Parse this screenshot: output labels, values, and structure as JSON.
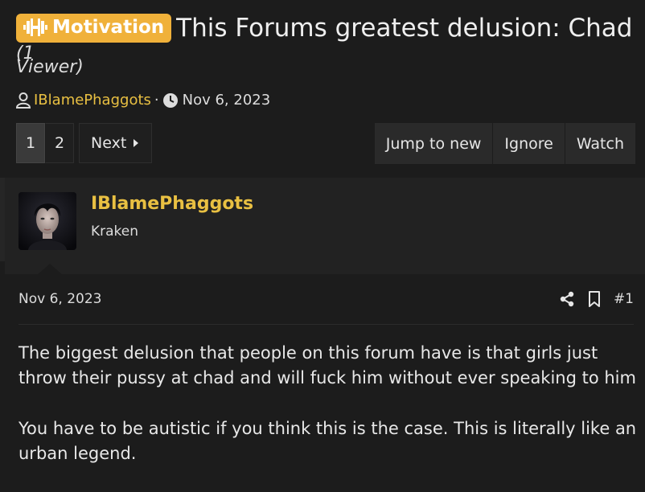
{
  "thread": {
    "prefix_label": "Motivation",
    "title": "This Forums greatest delusion: Chad",
    "viewer_count_part1": "(1",
    "viewer_count_part2": "Viewer)",
    "author": "IBlamePhaggots",
    "separator": "·",
    "date": "Nov 6, 2023"
  },
  "pagination": {
    "pages": [
      "1",
      "2"
    ],
    "current": "1",
    "next_label": "Next"
  },
  "actions": {
    "jump_label": "Jump to new",
    "ignore_label": "Ignore",
    "watch_label": "Watch"
  },
  "post": {
    "username": "IBlamePhaggots",
    "user_title": "Kraken",
    "date": "Nov 6, 2023",
    "post_number": "#1",
    "paragraphs": [
      "The biggest delusion that people on this forum have is that girls just throw their pussy at chad and will fuck him without ever speaking to him",
      "You have to be autistic if you think this is the case. This is literally like an urban legend."
    ]
  },
  "colors": {
    "background": "#1c1c1c",
    "prefix_bg": "#f0b13a",
    "username": "#e9c042",
    "button_bg": "#2a2a2a"
  },
  "icons": [
    "dumbbell-icon",
    "user-icon",
    "clock-icon",
    "caret-right-icon",
    "share-icon",
    "bookmark-icon"
  ]
}
